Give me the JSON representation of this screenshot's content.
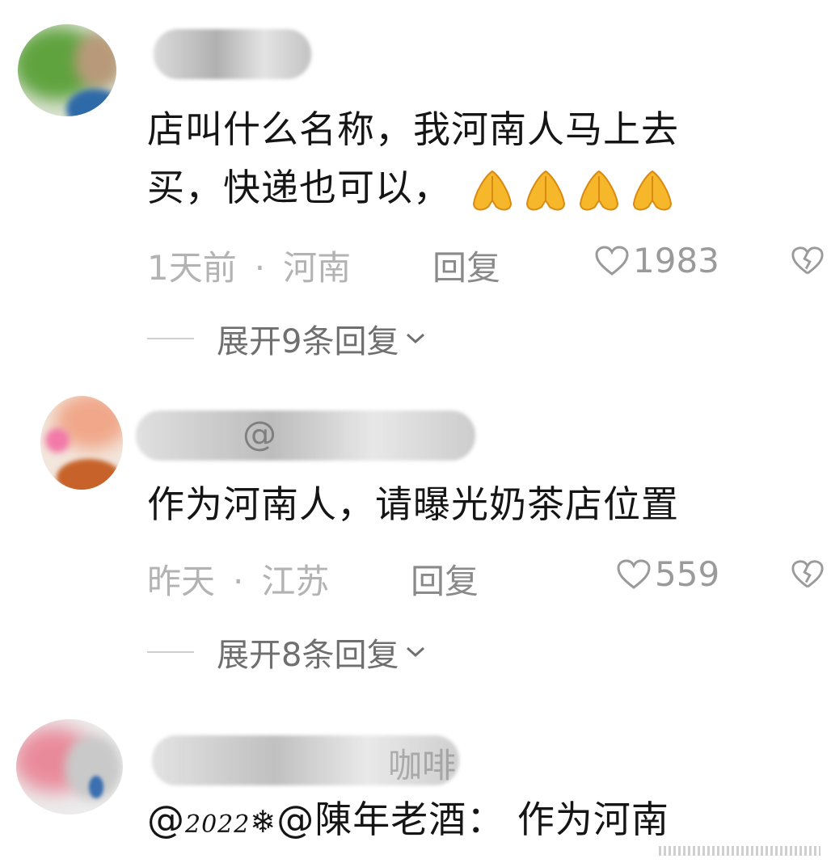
{
  "comments": [
    {
      "text_line1": "店叫什么名称，我河南人马上去",
      "text_line2": "买，快递也可以，",
      "emoji": "pray-hands-icon",
      "time": "1天前",
      "location": "河南",
      "reply_label": "回复",
      "likes": "1983",
      "expand_label": "展开9条回复"
    },
    {
      "text_line1": "作为河南人，请曝光奶茶店位置",
      "time": "昨天",
      "location": "江苏",
      "reply_label": "回复",
      "likes": "559",
      "expand_label": "展开8条回复",
      "username_fragment": "@"
    },
    {
      "text_prefix": "@",
      "text_styled_year": "2022",
      "text_snow": "❄",
      "text_mention": "@陳年老酒",
      "text_suffix": "： 作为河南",
      "username_fragment": "咖啡"
    }
  ],
  "colors": {
    "meta_gray": "#b3b3b3",
    "like_gray": "#9a9a9a",
    "text": "#151515"
  }
}
